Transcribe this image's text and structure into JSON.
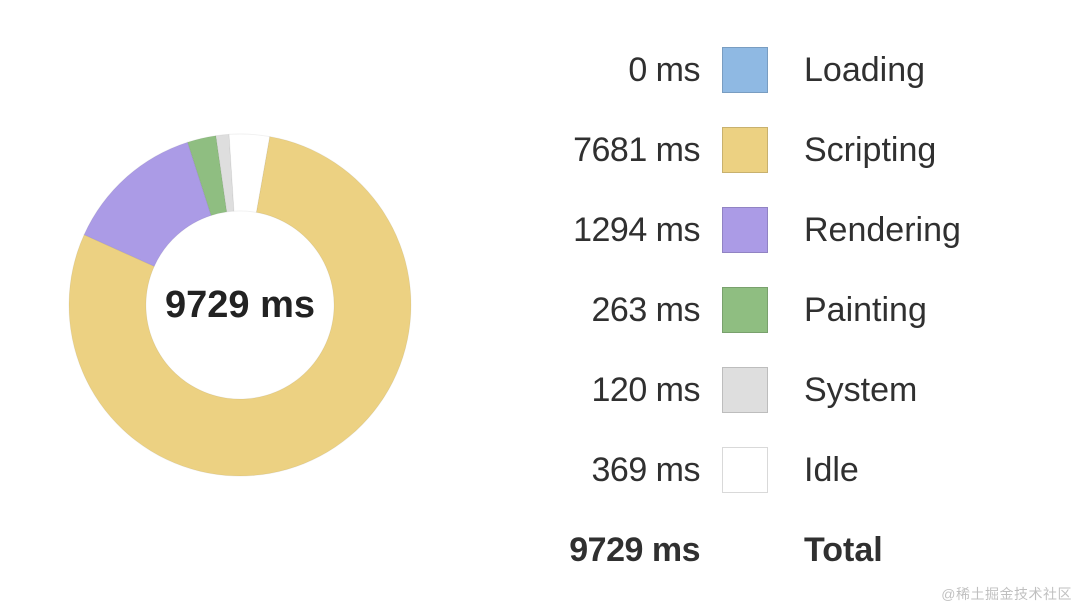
{
  "center_label": "9729 ms",
  "unit": "ms",
  "legend": [
    {
      "name": "Loading",
      "value_ms": 0,
      "display": "0 ms",
      "color": "#8fb9e3"
    },
    {
      "name": "Scripting",
      "value_ms": 7681,
      "display": "7681 ms",
      "color": "#ecd182"
    },
    {
      "name": "Rendering",
      "value_ms": 1294,
      "display": "1294 ms",
      "color": "#ab9be6"
    },
    {
      "name": "Painting",
      "value_ms": 263,
      "display": "263 ms",
      "color": "#8fbe81"
    },
    {
      "name": "System",
      "value_ms": 120,
      "display": "120 ms",
      "color": "#dedede"
    },
    {
      "name": "Idle",
      "value_ms": 369,
      "display": "369 ms",
      "color": "#ffffff"
    }
  ],
  "total": {
    "name": "Total",
    "display": "9729 ms",
    "value_ms": 9729
  },
  "watermark": "@稀土掘金技术社区",
  "chart_data": {
    "type": "pie",
    "title": "",
    "series": [
      {
        "name": "Loading",
        "value": 0,
        "color": "#8fb9e3"
      },
      {
        "name": "Scripting",
        "value": 7681,
        "color": "#ecd182"
      },
      {
        "name": "Rendering",
        "value": 1294,
        "color": "#ab9be6"
      },
      {
        "name": "Painting",
        "value": 263,
        "color": "#8fbe81"
      },
      {
        "name": "System",
        "value": 120,
        "color": "#dedede"
      },
      {
        "name": "Idle",
        "value": 369,
        "color": "#ffffff"
      }
    ],
    "total": 9729,
    "inner_radius_ratio": 0.55,
    "start_angle_deg": -80
  }
}
